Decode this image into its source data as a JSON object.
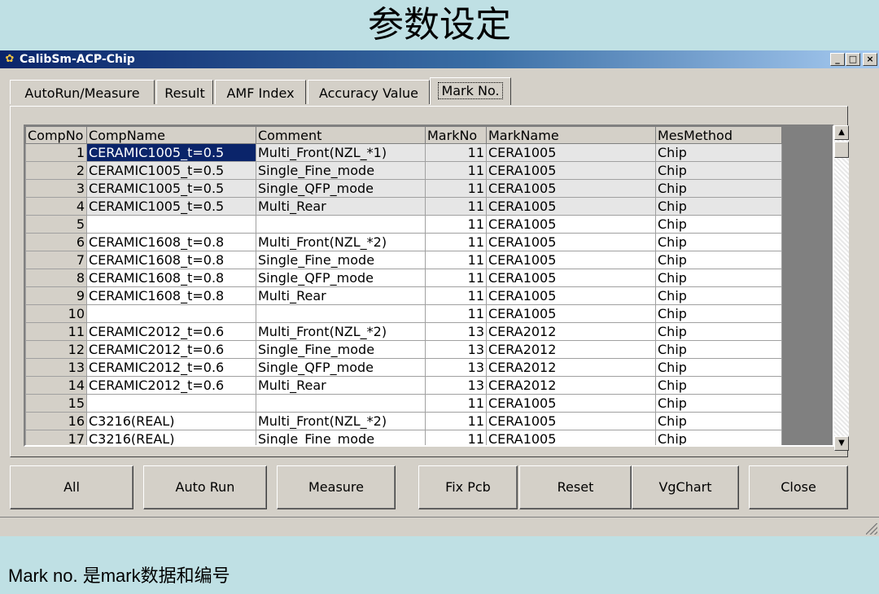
{
  "slide": {
    "title": "参数设定",
    "caption": "Mark no.  是mark数据和编号"
  },
  "window": {
    "title": "CalibSm-ACP-Chip",
    "minimize": "_",
    "maximize": "□",
    "close": "×"
  },
  "tabs": [
    {
      "label": "AutoRun/Measure"
    },
    {
      "label": "Result"
    },
    {
      "label": "AMF Index"
    },
    {
      "label": "Accuracy Value"
    },
    {
      "label": "Mark No."
    }
  ],
  "grid": {
    "columns": [
      "CompNo",
      "CompName",
      "Comment",
      "MarkNo",
      "MarkName",
      "MesMethod"
    ],
    "rows": [
      [
        "1",
        "CERAMIC1005_t=0.5",
        "Multi_Front(NZL_*1)",
        "11",
        "CERA1005",
        "Chip"
      ],
      [
        "2",
        "CERAMIC1005_t=0.5",
        "Single_Fine_mode",
        "11",
        "CERA1005",
        "Chip"
      ],
      [
        "3",
        "CERAMIC1005_t=0.5",
        "Single_QFP_mode",
        "11",
        "CERA1005",
        "Chip"
      ],
      [
        "4",
        "CERAMIC1005_t=0.5",
        "Multi_Rear",
        "11",
        "CERA1005",
        "Chip"
      ],
      [
        "5",
        "",
        "",
        "11",
        "CERA1005",
        "Chip"
      ],
      [
        "6",
        "CERAMIC1608_t=0.8",
        "Multi_Front(NZL_*2)",
        "11",
        "CERA1005",
        "Chip"
      ],
      [
        "7",
        "CERAMIC1608_t=0.8",
        "Single_Fine_mode",
        "11",
        "CERA1005",
        "Chip"
      ],
      [
        "8",
        "CERAMIC1608_t=0.8",
        "Single_QFP_mode",
        "11",
        "CERA1005",
        "Chip"
      ],
      [
        "9",
        "CERAMIC1608_t=0.8",
        "Multi_Rear",
        "11",
        "CERA1005",
        "Chip"
      ],
      [
        "10",
        "",
        "",
        "11",
        "CERA1005",
        "Chip"
      ],
      [
        "11",
        "CERAMIC2012_t=0.6",
        "Multi_Front(NZL_*2)",
        "13",
        "CERA2012",
        "Chip"
      ],
      [
        "12",
        "CERAMIC2012_t=0.6",
        "Single_Fine_mode",
        "13",
        "CERA2012",
        "Chip"
      ],
      [
        "13",
        "CERAMIC2012_t=0.6",
        "Single_QFP_mode",
        "13",
        "CERA2012",
        "Chip"
      ],
      [
        "14",
        "CERAMIC2012_t=0.6",
        "Multi_Rear",
        "13",
        "CERA2012",
        "Chip"
      ],
      [
        "15",
        "",
        "",
        "11",
        "CERA1005",
        "Chip"
      ],
      [
        "16",
        "C3216(REAL)",
        "Multi_Front(NZL_*2)",
        "11",
        "CERA1005",
        "Chip"
      ],
      [
        "17",
        "C3216(REAL)",
        "Single_Fine_mode",
        "11",
        "CERA1005",
        "Chip"
      ]
    ]
  },
  "buttons": {
    "all": "All",
    "auto_run": "Auto Run",
    "measure": "Measure",
    "fix_pcb": "Fix Pcb",
    "reset": "Reset",
    "vgchart": "VgChart",
    "close": "Close"
  },
  "icons": {
    "app": "app-icon",
    "scroll_up": "scroll-up-arrow-icon",
    "scroll_down": "scroll-down-arrow-icon",
    "resize_grip": "resize-grip-icon"
  }
}
